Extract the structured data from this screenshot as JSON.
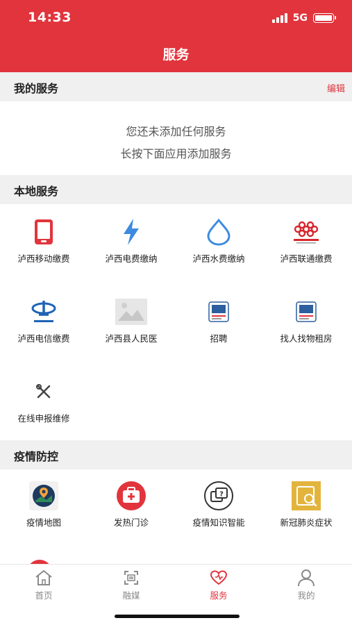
{
  "status_bar": {
    "time": "14:33",
    "network": "5G"
  },
  "header": {
    "title": "服务"
  },
  "my_services": {
    "title": "我的服务",
    "edit_label": "编辑",
    "empty_line1": "您还未添加任何服务",
    "empty_line2": "长按下面应用添加服务"
  },
  "local_services": {
    "title": "本地服务",
    "items": [
      {
        "label": "泸西移动缴费",
        "icon": "phone-icon"
      },
      {
        "label": "泸西电费缴纳",
        "icon": "lightning-icon"
      },
      {
        "label": "泸西水费缴纳",
        "icon": "water-drop-icon"
      },
      {
        "label": "泸西联通缴费",
        "icon": "china-unicom-logo"
      },
      {
        "label": "泸西电信缴费",
        "icon": "china-telecom-logo"
      },
      {
        "label": "泸西县人民医",
        "icon": "image-placeholder-icon"
      },
      {
        "label": "招聘",
        "icon": "app-thumbnail-icon"
      },
      {
        "label": "找人找物租房",
        "icon": "app-thumbnail-icon"
      },
      {
        "label": "在线申报维修",
        "icon": "tools-icon"
      }
    ]
  },
  "epidemic": {
    "title": "疫情防控",
    "items": [
      {
        "label": "疫情地图",
        "icon": "map-icon"
      },
      {
        "label": "发热门诊",
        "icon": "medical-kit-icon"
      },
      {
        "label": "疫情知识智能",
        "icon": "question-chat-icon"
      },
      {
        "label": "新冠肺炎症状",
        "icon": "search-document-icon"
      }
    ]
  },
  "tabbar": {
    "items": [
      {
        "label": "首页",
        "icon": "home-icon",
        "active": false
      },
      {
        "label": "融媒",
        "icon": "media-icon",
        "active": false
      },
      {
        "label": "服务",
        "icon": "heart-icon",
        "active": true
      },
      {
        "label": "我的",
        "icon": "user-icon",
        "active": false
      }
    ]
  },
  "colors": {
    "brand_red": "#e1343c",
    "section_bg": "#f0f0f0",
    "inactive_tab": "#8a8a8a"
  }
}
